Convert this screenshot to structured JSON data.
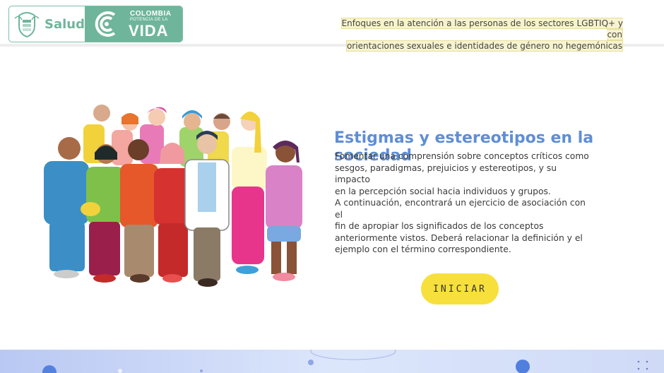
{
  "header": {
    "logo": {
      "salud": "Salud",
      "colombia": "COLOMBIA",
      "potencia": "POTENCIA DE LA",
      "vida": "VIDA"
    },
    "title_line1": "Enfoques en la atención a las personas de los sectores LGBTIQ+ y con",
    "title_line2": "orientaciones sexuales e identidades de género no hegemónicas"
  },
  "main": {
    "title": "Estigmas y estereotipos en la sociedad",
    "paragraph1_lines": [
      "Fomentar una comprensión sobre conceptos críticos como",
      "sesgos, paradigmas, prejuicios y estereotipos, y su impacto",
      "en la percepción social hacia individuos y grupos."
    ],
    "paragraph2_lines": [
      "A continuación, encontrará un ejercicio de asociación con el",
      "fin de apropiar los significados de los conceptos",
      "anteriormente vistos. Deberá relacionar la definición y el",
      "ejemplo con el término correspondiente."
    ],
    "start_button": "INICIAR"
  },
  "colors": {
    "accent_green": "#6fb59b",
    "title_blue": "#5f8ed6",
    "button_yellow": "#f7e03c",
    "header_highlight": "#f7f3cf"
  },
  "icons": [
    "colombia-shield-icon",
    "colombia-potencia-icon",
    "fullscreen-icon"
  ]
}
